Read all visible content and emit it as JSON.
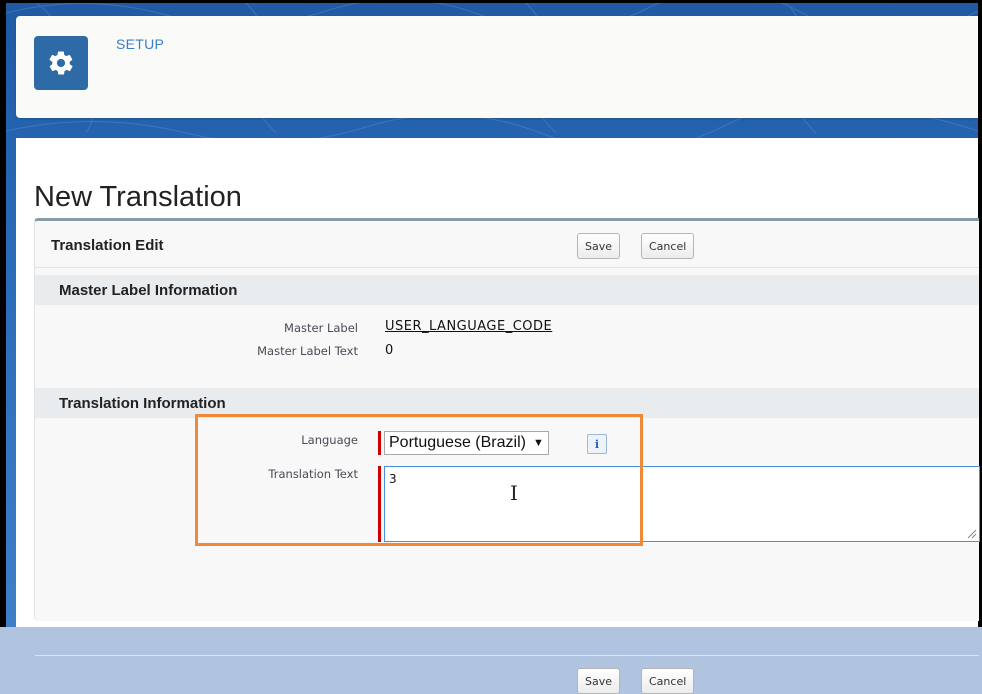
{
  "header": {
    "app_label": "SETUP",
    "icon": "gear-icon"
  },
  "page": {
    "title": "New Translation"
  },
  "block": {
    "title": "Translation Edit",
    "save_label": "Save",
    "cancel_label": "Cancel"
  },
  "master_section": {
    "title": "Master Label Information",
    "fields": [
      {
        "label": "Master Label",
        "value": "USER_LANGUAGE_CODE"
      },
      {
        "label": "Master Label Text",
        "value": "0"
      }
    ]
  },
  "translation_section": {
    "title": "Translation Information",
    "language_label": "Language",
    "language_value": "Portuguese (Brazil)",
    "info_glyph": "i",
    "text_label": "Translation Text",
    "text_value": "3"
  },
  "colors": {
    "accent": "#2e6aa6",
    "required": "#cc0000",
    "highlight": "#ef8a3a"
  }
}
